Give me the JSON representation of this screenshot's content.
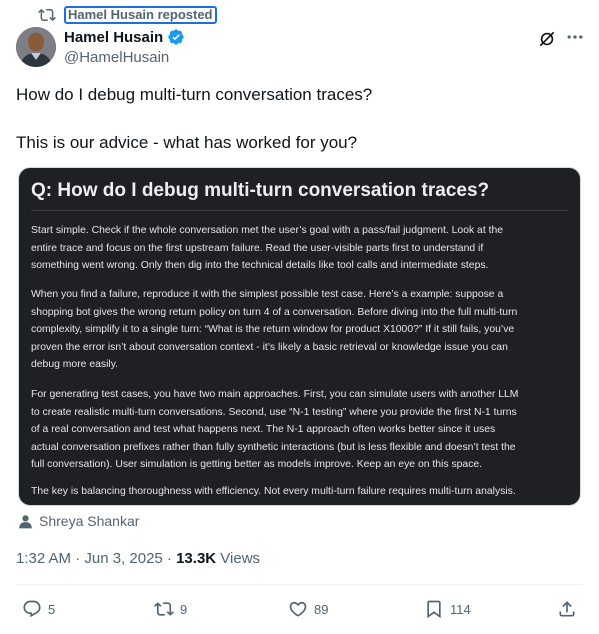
{
  "repost": {
    "label": "Hamel Husain reposted",
    "icon": "repost-icon"
  },
  "author": {
    "name": "Hamel Husain",
    "handle": "@HamelHusain",
    "verified": true,
    "verified_color": "#1d9bf0"
  },
  "tweet": {
    "line1": "How do I debug multi-turn conversation traces?",
    "line2": "This is our advice - what has worked for you?"
  },
  "media": {
    "title": "Q: How do I debug multi-turn conversation traces?",
    "paragraphs": [
      [
        "Start simple. Check if the whole conversation met the user’s goal with a pass/fail judgment. Look at the",
        "entire trace and focus on the first upstream failure. Read the user-visible parts first to understand if",
        "something went wrong. Only then dig into the technical details like tool calls and intermediate steps."
      ],
      [
        "When you find a failure, reproduce it with the simplest possible test case. Here’s a example: suppose a",
        "shopping bot gives the wrong return policy on turn 4 of a conversation. Before diving into the full multi-turn",
        "complexity, simplify it to a single turn: “What is the return window for product X1000?” If it still fails, you’ve",
        "proven the error isn’t about conversation context - it’s likely a basic retrieval or knowledge issue you can",
        "debug more easily."
      ],
      [
        "For generating test cases, you have two main approaches. First, you can simulate users with another LLM",
        "to create realistic multi-turn conversations. Second, use “N-1 testing” where you provide the first N-1 turns",
        "of a real conversation and test what happens next. The N-1 approach often works better since it uses",
        "actual conversation prefixes rather than fully synthetic interactions (but is less flexible and doesn’t test the",
        "full conversation). User simulation is getting better as models improve. Keep an eye on this space."
      ],
      [
        "The key is balancing thoroughness with efficiency. Not every multi-turn failure requires multi-turn analysis."
      ]
    ]
  },
  "tagged_user": "Shreya Shankar",
  "meta": {
    "time": "1:32 AM · Jun 3, 2025 · ",
    "views": "13.3K",
    "views_label": " Views"
  },
  "actions": {
    "replies": "5",
    "reposts": "9",
    "likes": "89",
    "bookmarks": "114"
  }
}
